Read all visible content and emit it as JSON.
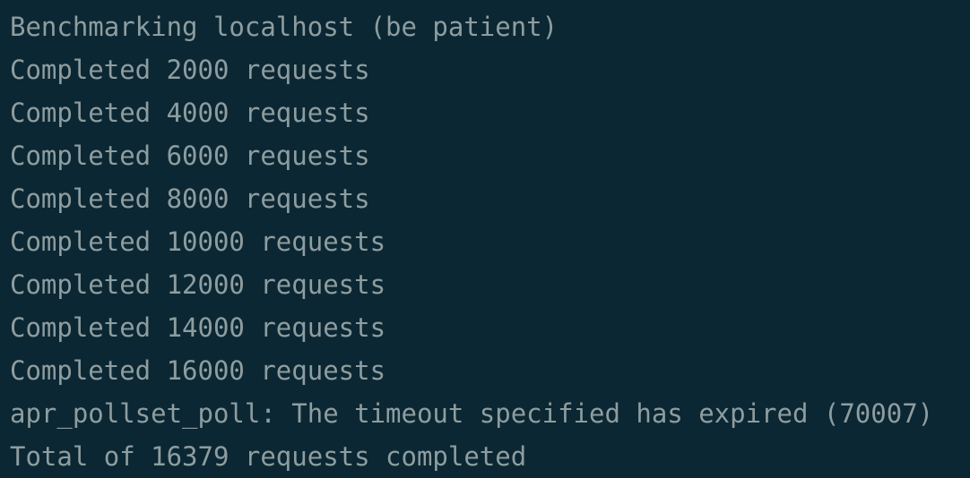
{
  "terminal": {
    "lines": [
      "Benchmarking localhost (be patient)",
      "Completed 2000 requests",
      "Completed 4000 requests",
      "Completed 6000 requests",
      "Completed 8000 requests",
      "Completed 10000 requests",
      "Completed 12000 requests",
      "Completed 14000 requests",
      "Completed 16000 requests",
      "apr_pollset_poll: The timeout specified has expired (70007)",
      "Total of 16379 requests completed"
    ]
  },
  "colors": {
    "background": "#0b2733",
    "text": "#8e9d9f"
  }
}
